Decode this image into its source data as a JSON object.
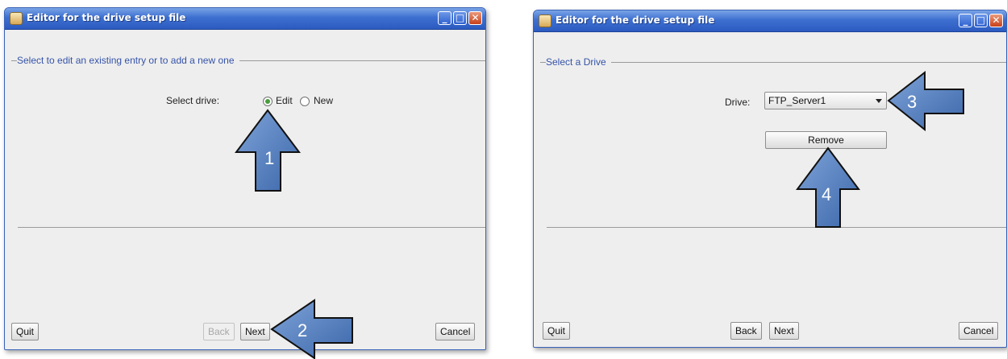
{
  "window_title": "Editor for the drive setup file",
  "left_window": {
    "section_label": "Select to edit an existing entry or to add a new one",
    "select_label": "Select drive:",
    "radio_edit": "Edit",
    "radio_new": "New",
    "selected_option": "Edit",
    "buttons": {
      "quit": "Quit",
      "back": "Back",
      "next": "Next",
      "cancel": "Cancel"
    }
  },
  "right_window": {
    "section_label": "Select a Drive",
    "drive_label": "Drive:",
    "drive_value": "FTP_Server1",
    "remove": "Remove",
    "buttons": {
      "quit": "Quit",
      "back": "Back",
      "next": "Next",
      "cancel": "Cancel"
    }
  },
  "callouts": [
    "1",
    "2",
    "3",
    "4"
  ],
  "colors": {
    "titlebar": "#2c5bc0",
    "arrow": "#4a76b8",
    "section_text": "#3553a8"
  }
}
